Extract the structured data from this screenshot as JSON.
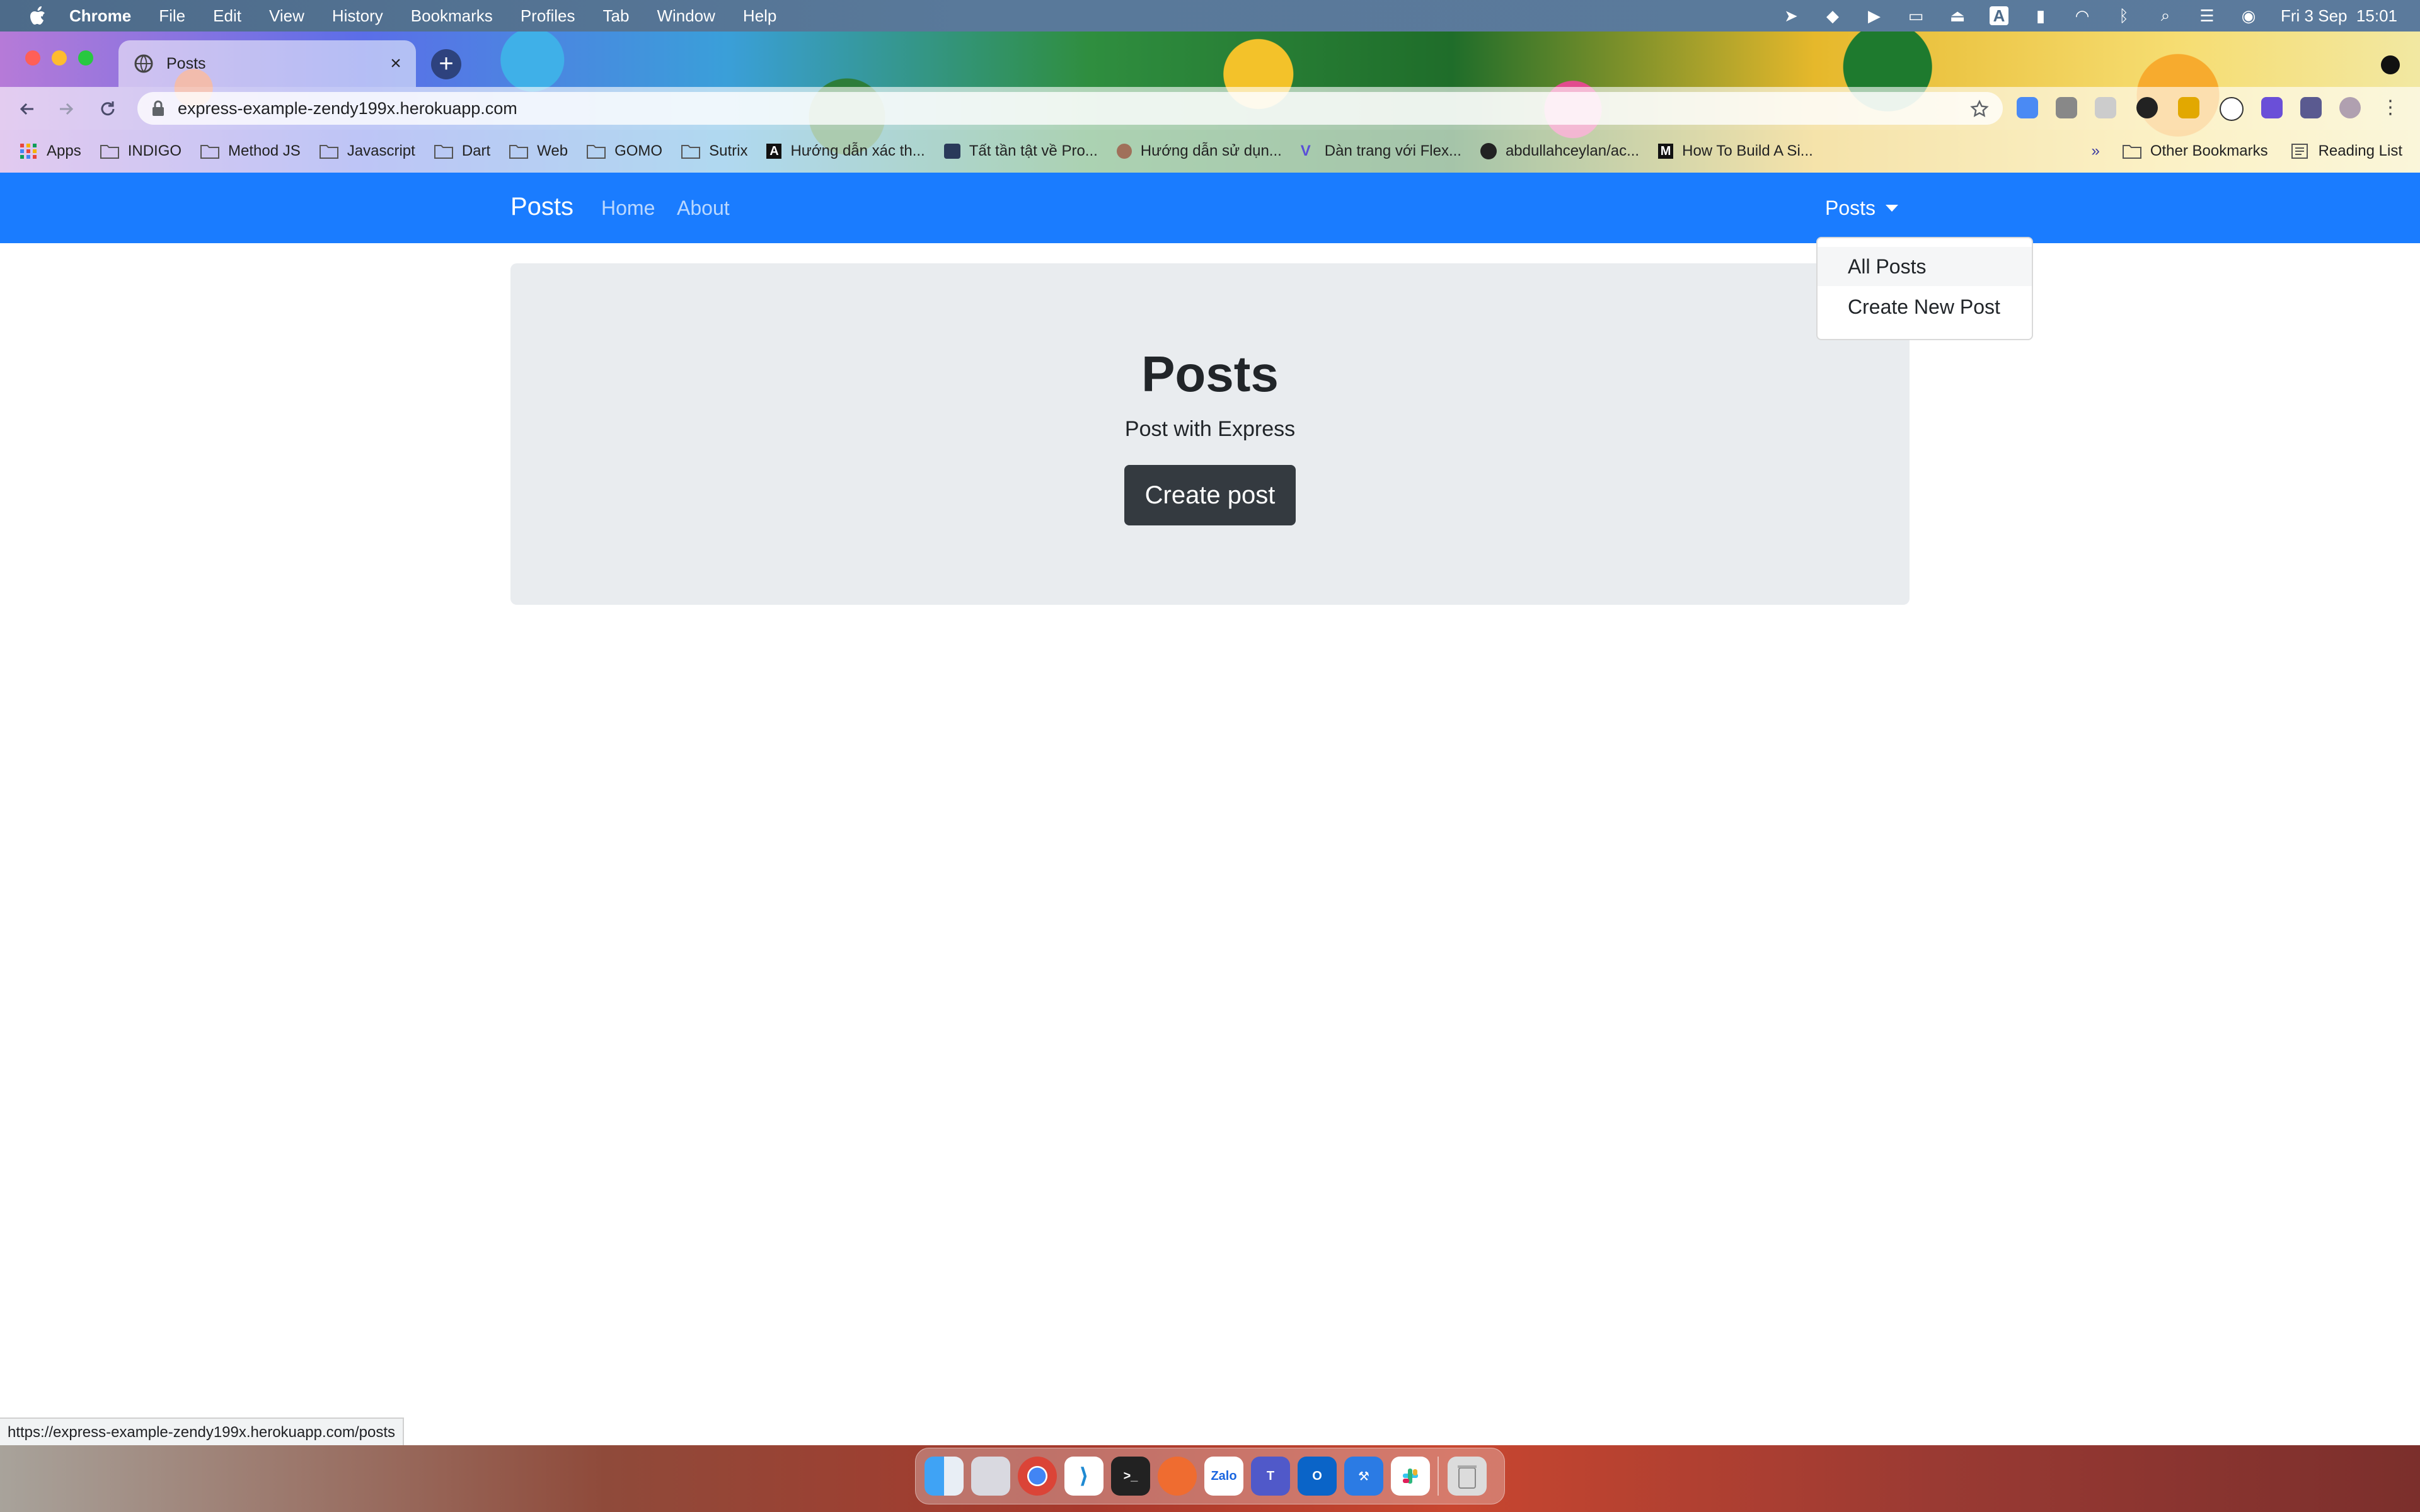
{
  "menubar": {
    "app_name": "Chrome",
    "items": [
      "File",
      "Edit",
      "View",
      "History",
      "Bookmarks",
      "Profiles",
      "Tab",
      "Window",
      "Help"
    ],
    "clock": "Fri 3 Sep  15:01",
    "input_source": "A"
  },
  "browser": {
    "tab_title": "Posts",
    "url": "express-example-zendy199x.herokuapp.com",
    "status_url": "https://express-example-zendy199x.herokuapp.com/posts",
    "bookmarks": [
      {
        "label": "Apps",
        "icon": "apps-grid-icon"
      },
      {
        "label": "INDIGO",
        "icon": "folder-icon"
      },
      {
        "label": "Method JS",
        "icon": "folder-icon"
      },
      {
        "label": "Javascript",
        "icon": "folder-icon"
      },
      {
        "label": "Dart",
        "icon": "folder-icon"
      },
      {
        "label": "Web",
        "icon": "folder-icon"
      },
      {
        "label": "GOMO",
        "icon": "folder-icon"
      },
      {
        "label": "Sutrix",
        "icon": "folder-icon"
      },
      {
        "label": "Hướng dẫn xác th...",
        "icon": "site-icon"
      },
      {
        "label": "Tất tần tật về Pro...",
        "icon": "site-icon"
      },
      {
        "label": "Hướng dẫn sử dụn...",
        "icon": "site-icon"
      },
      {
        "label": "Dàn trang với Flex...",
        "icon": "site-icon"
      },
      {
        "label": "abdullahceylan/ac...",
        "icon": "github-icon"
      },
      {
        "label": "How To Build A Si...",
        "icon": "medium-icon"
      }
    ],
    "bookmarks_overflow": "»",
    "other_bookmarks": "Other Bookmarks",
    "reading_list": "Reading List"
  },
  "app": {
    "brand": "Posts",
    "nav": {
      "home": "Home",
      "about": "About"
    },
    "dropdown": {
      "label": "Posts",
      "items": [
        "All Posts",
        "Create New Post"
      ]
    },
    "jumbotron": {
      "title": "Posts",
      "subtitle": "Post with Express",
      "button": "Create post"
    }
  },
  "dock": {
    "apps": [
      "Finder",
      "Launchpad",
      "Chrome",
      "VS Code",
      "Terminal",
      "Postman",
      "Zalo",
      "Teams",
      "Outlook",
      "Xcode",
      "Slack",
      "Trash"
    ]
  },
  "colors": {
    "navbar": "#1a7cff",
    "jumbotron": "#e9ecef",
    "button": "#343a40"
  }
}
